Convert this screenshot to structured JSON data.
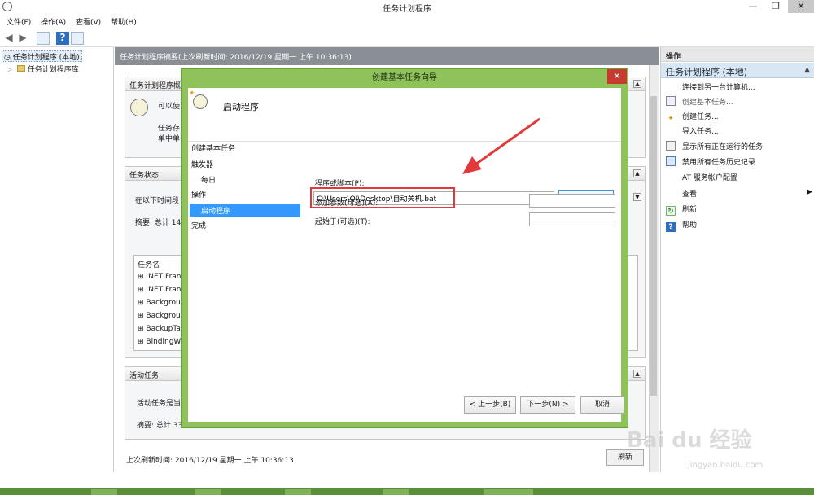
{
  "window": {
    "title": "任务计划程序",
    "min": "—",
    "max": "❐",
    "close": "✕"
  },
  "menu": [
    "文件(F)",
    "操作(A)",
    "查看(V)",
    "帮助(H)"
  ],
  "toolbar": {
    "back": "◀",
    "forward": "▶",
    "help": "?"
  },
  "tree": {
    "root": "任务计划程序 (本地)",
    "library": "任务计划程序库",
    "expander": "▷"
  },
  "center": {
    "header": "任务计划程序摘要(上次刷新时间: 2016/12/19 星期一 上午 10:36:13)",
    "overview_title": "任务计划程序概",
    "overview_line1": "可以使",
    "overview_line2": "任务存",
    "overview_line3": "单中单",
    "status_title": "任务状态",
    "status_line": "在以下时间段",
    "status_summary": "摘要: 总计 14",
    "task_col": "任务名",
    "tasks": [
      ".NET Fran",
      ".NET Fran",
      "Backgrou",
      "Backgrou",
      "BackupTa",
      "BindingW"
    ],
    "active_title": "活动任务",
    "active_line": "活动任务是当",
    "active_summary": "摘要: 总计 33 个",
    "last_refresh": "上次刷新时间: 2016/12/19 星期一 上午 10:36:13",
    "refresh_btn": "刷新"
  },
  "actions": {
    "header": "操作",
    "section": "任务计划程序 (本地)",
    "items": [
      {
        "label": "连接到另一台计算机...",
        "icon": ""
      },
      {
        "label": "创建基本任务...",
        "icon": "calendar-icon"
      },
      {
        "label": "创建任务...",
        "icon": "task-icon"
      },
      {
        "label": "导入任务...",
        "icon": ""
      },
      {
        "label": "显示所有正在运行的任务",
        "icon": "list-icon"
      },
      {
        "label": "禁用所有任务历史记录",
        "icon": "history-icon"
      },
      {
        "label": "AT 服务帐户配置",
        "icon": ""
      },
      {
        "label": "查看",
        "icon": ""
      },
      {
        "label": "刷新",
        "icon": "refresh-icon"
      },
      {
        "label": "帮助",
        "icon": "help-icon"
      }
    ],
    "submenu_arrow": "▶"
  },
  "dialog": {
    "title": "创建基本任务向导",
    "close": "✕",
    "heading": "启动程序",
    "steps": [
      "创建基本任务",
      "触发器",
      "每日",
      "操作",
      "启动程序",
      "完成"
    ],
    "prog_label": "程序或脚本(P):",
    "prog_value": "C:\\Users\\QI\\Desktop\\自动关机.bat",
    "browse": "浏览(R)...",
    "args_label": "添加参数(可选)(A):",
    "start_label": "起始于(可选)(T):",
    "back": "< 上一步(B)",
    "next": "下一步(N) >",
    "cancel": "取消"
  },
  "watermark": {
    "main": "Bai du 经验",
    "sub": "jingyan.baidu.com"
  },
  "colors": {
    "dialog_frame": "#8fc25a",
    "highlight": "#e23a3a",
    "arrow": "#e23a3a",
    "selection": "#3399ff"
  }
}
